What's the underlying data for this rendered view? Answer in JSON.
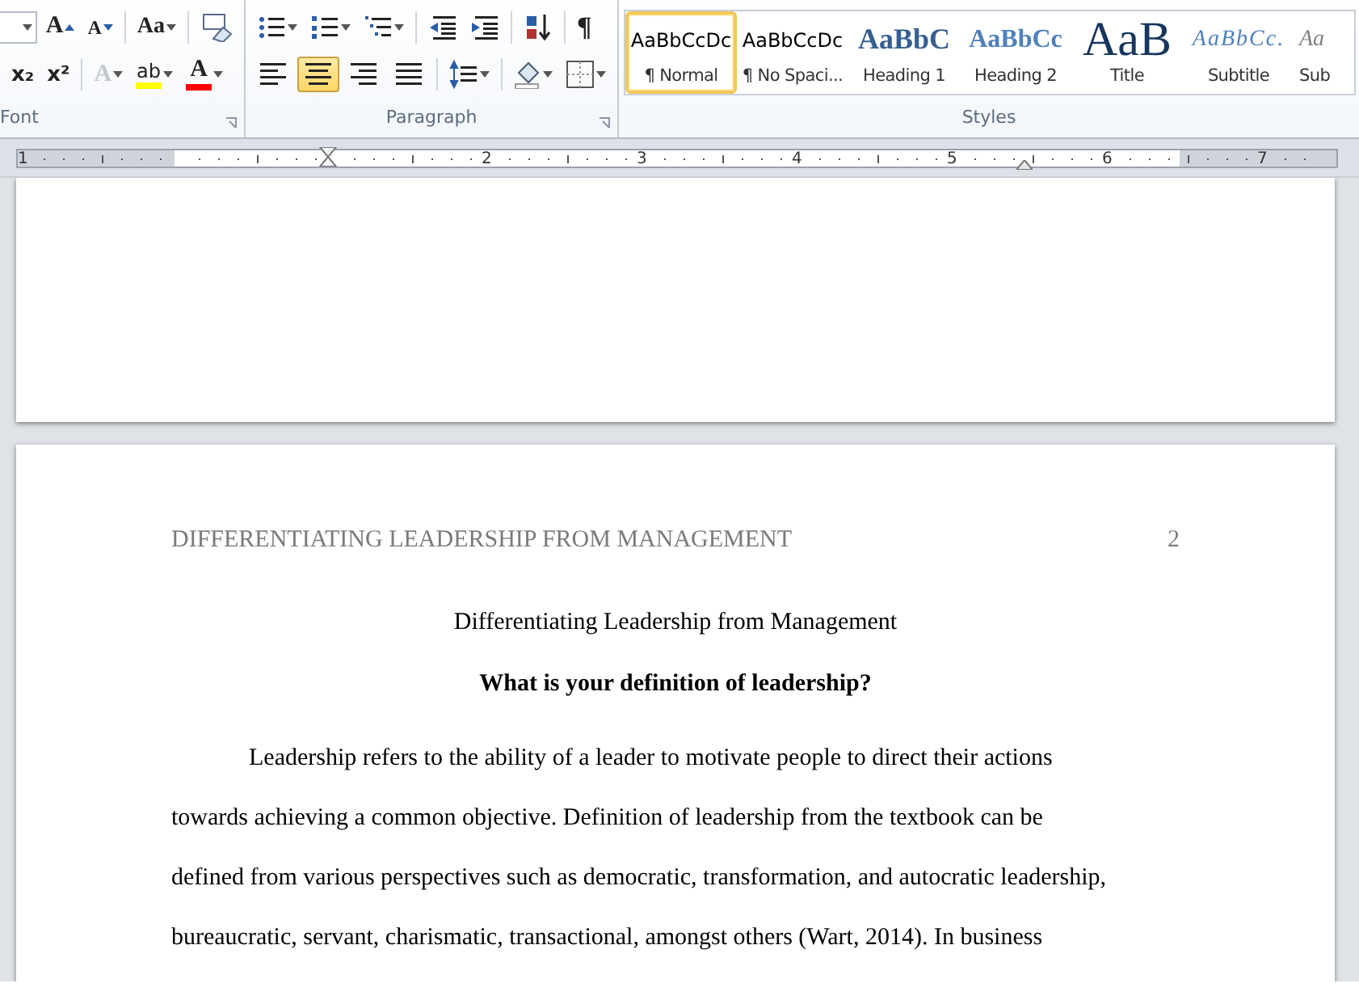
{
  "ribbon": {
    "font_group": {
      "label": "Font",
      "row1": [
        {
          "kind": "field"
        },
        {
          "kind": "grow",
          "glyph": "A"
        },
        {
          "kind": "shrink",
          "glyph": "A"
        },
        {
          "kind": "case",
          "glyph": "Aa",
          "dropdown": true
        },
        {
          "kind": "eraser"
        }
      ],
      "row2": [
        {
          "kind": "sub",
          "glyph": "x₂"
        },
        {
          "kind": "sup",
          "glyph": "x²"
        },
        {
          "kind": "effects",
          "glyph": "A",
          "disabled": true,
          "dropdown": true
        },
        {
          "kind": "highlight",
          "glyph": "ab",
          "color": "#ffff00",
          "dropdown": true
        },
        {
          "kind": "fontcolor",
          "glyph": "A",
          "color": "#ff0000",
          "dropdown": true
        }
      ]
    },
    "paragraph_group": {
      "label": "Paragraph",
      "row1": [
        {
          "kind": "bullets",
          "dropdown": true
        },
        {
          "kind": "numbering",
          "dropdown": true
        },
        {
          "kind": "multilevel",
          "dropdown": true
        },
        {
          "kind": "outdent"
        },
        {
          "kind": "indent"
        },
        {
          "kind": "sort"
        },
        {
          "kind": "pilcrow",
          "glyph": "¶"
        }
      ],
      "align": [
        {
          "kind": "left",
          "selected": false
        },
        {
          "kind": "center",
          "selected": true
        },
        {
          "kind": "right",
          "selected": false
        },
        {
          "kind": "justify",
          "selected": false
        }
      ],
      "row2": [
        {
          "kind": "spacing",
          "dropdown": true
        },
        {
          "kind": "shading",
          "dropdown": true
        },
        {
          "kind": "borders",
          "dropdown": true
        }
      ]
    },
    "styles_group": {
      "label": "Styles",
      "items": [
        {
          "preview": "AaBbCcDc",
          "label": "¶ Normal",
          "kind": "normal",
          "selected": true
        },
        {
          "preview": "AaBbCcDc",
          "label": "¶ No Spaci...",
          "kind": "normal",
          "selected": false
        },
        {
          "preview": "AaBbC",
          "label": "Heading 1",
          "kind": "heading1",
          "selected": false
        },
        {
          "preview": "AaBbCc",
          "label": "Heading 2",
          "kind": "heading2",
          "selected": false
        },
        {
          "preview": "AaB",
          "label": "Title",
          "kind": "title",
          "selected": false
        },
        {
          "preview": "AaBbCc.",
          "label": "Subtitle",
          "kind": "subtitle",
          "selected": false
        },
        {
          "preview": "Aa",
          "label": "Sub",
          "kind": "subtle",
          "selected": false
        }
      ]
    }
  },
  "ruler": {
    "numbers": [
      "1",
      "2",
      "3",
      "4",
      "5",
      "6",
      "7"
    ]
  },
  "page2": {
    "header": "DIFFERENTIATING LEADERSHIP FROM MANAGEMENT",
    "page_number": "2",
    "title": "Differentiating Leadership from Management",
    "heading": "What is your definition of leadership?",
    "paragraph_lines": [
      "Leadership refers to the ability of a leader to motivate people to direct their actions",
      "towards achieving a common objective. Definition of leadership from the textbook can be",
      "defined from various perspectives such as democratic, transformation, and autocratic leadership,",
      "bureaucratic, servant, charismatic, transactional, amongst others (Wart, 2014). In business"
    ]
  }
}
